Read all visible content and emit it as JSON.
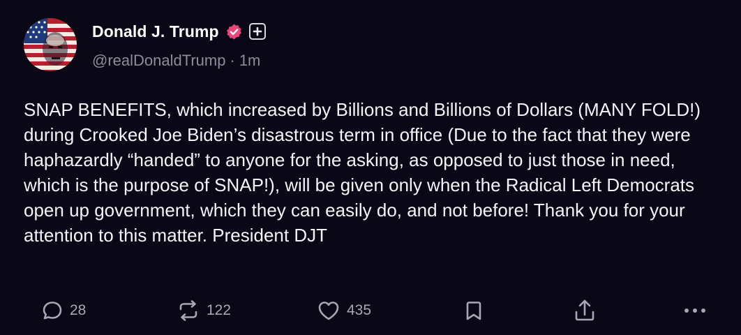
{
  "post": {
    "author": {
      "display_name": "Donald J. Trump",
      "handle": "@realDonaldTrump",
      "separator": "·",
      "time_ago": "1m",
      "avatar_icon": "flag-portrait-avatar",
      "verified_icon": "verified-badge-icon",
      "verified_color": "#e6467a",
      "plus_icon": "plus-box-icon"
    },
    "text": "SNAP BENEFITS, which increased by Billions and Billions of Dollars (MANY FOLD!) during Crooked Joe Biden’s disastrous term in office (Due to the fact that they were haphazardly “handed” to anyone for the asking, as opposed to just those in need, which is the purpose of SNAP!), will be given only when the Radical Left Democrats open up government, which they can easily do, and not before! Thank you for your attention to this matter. President DJT",
    "actions": {
      "replies": {
        "icon": "comment-icon",
        "count": "28"
      },
      "reposts": {
        "icon": "repost-icon",
        "count": "122"
      },
      "likes": {
        "icon": "heart-icon",
        "count": "435"
      },
      "bookmark": {
        "icon": "bookmark-icon"
      },
      "share": {
        "icon": "share-icon"
      },
      "more": {
        "icon": "more-dots-icon"
      }
    }
  },
  "colors": {
    "background": "#0a0816",
    "text_primary": "#ffffff",
    "text_secondary": "#8e8c9b",
    "icon": "#a9a7b5"
  }
}
